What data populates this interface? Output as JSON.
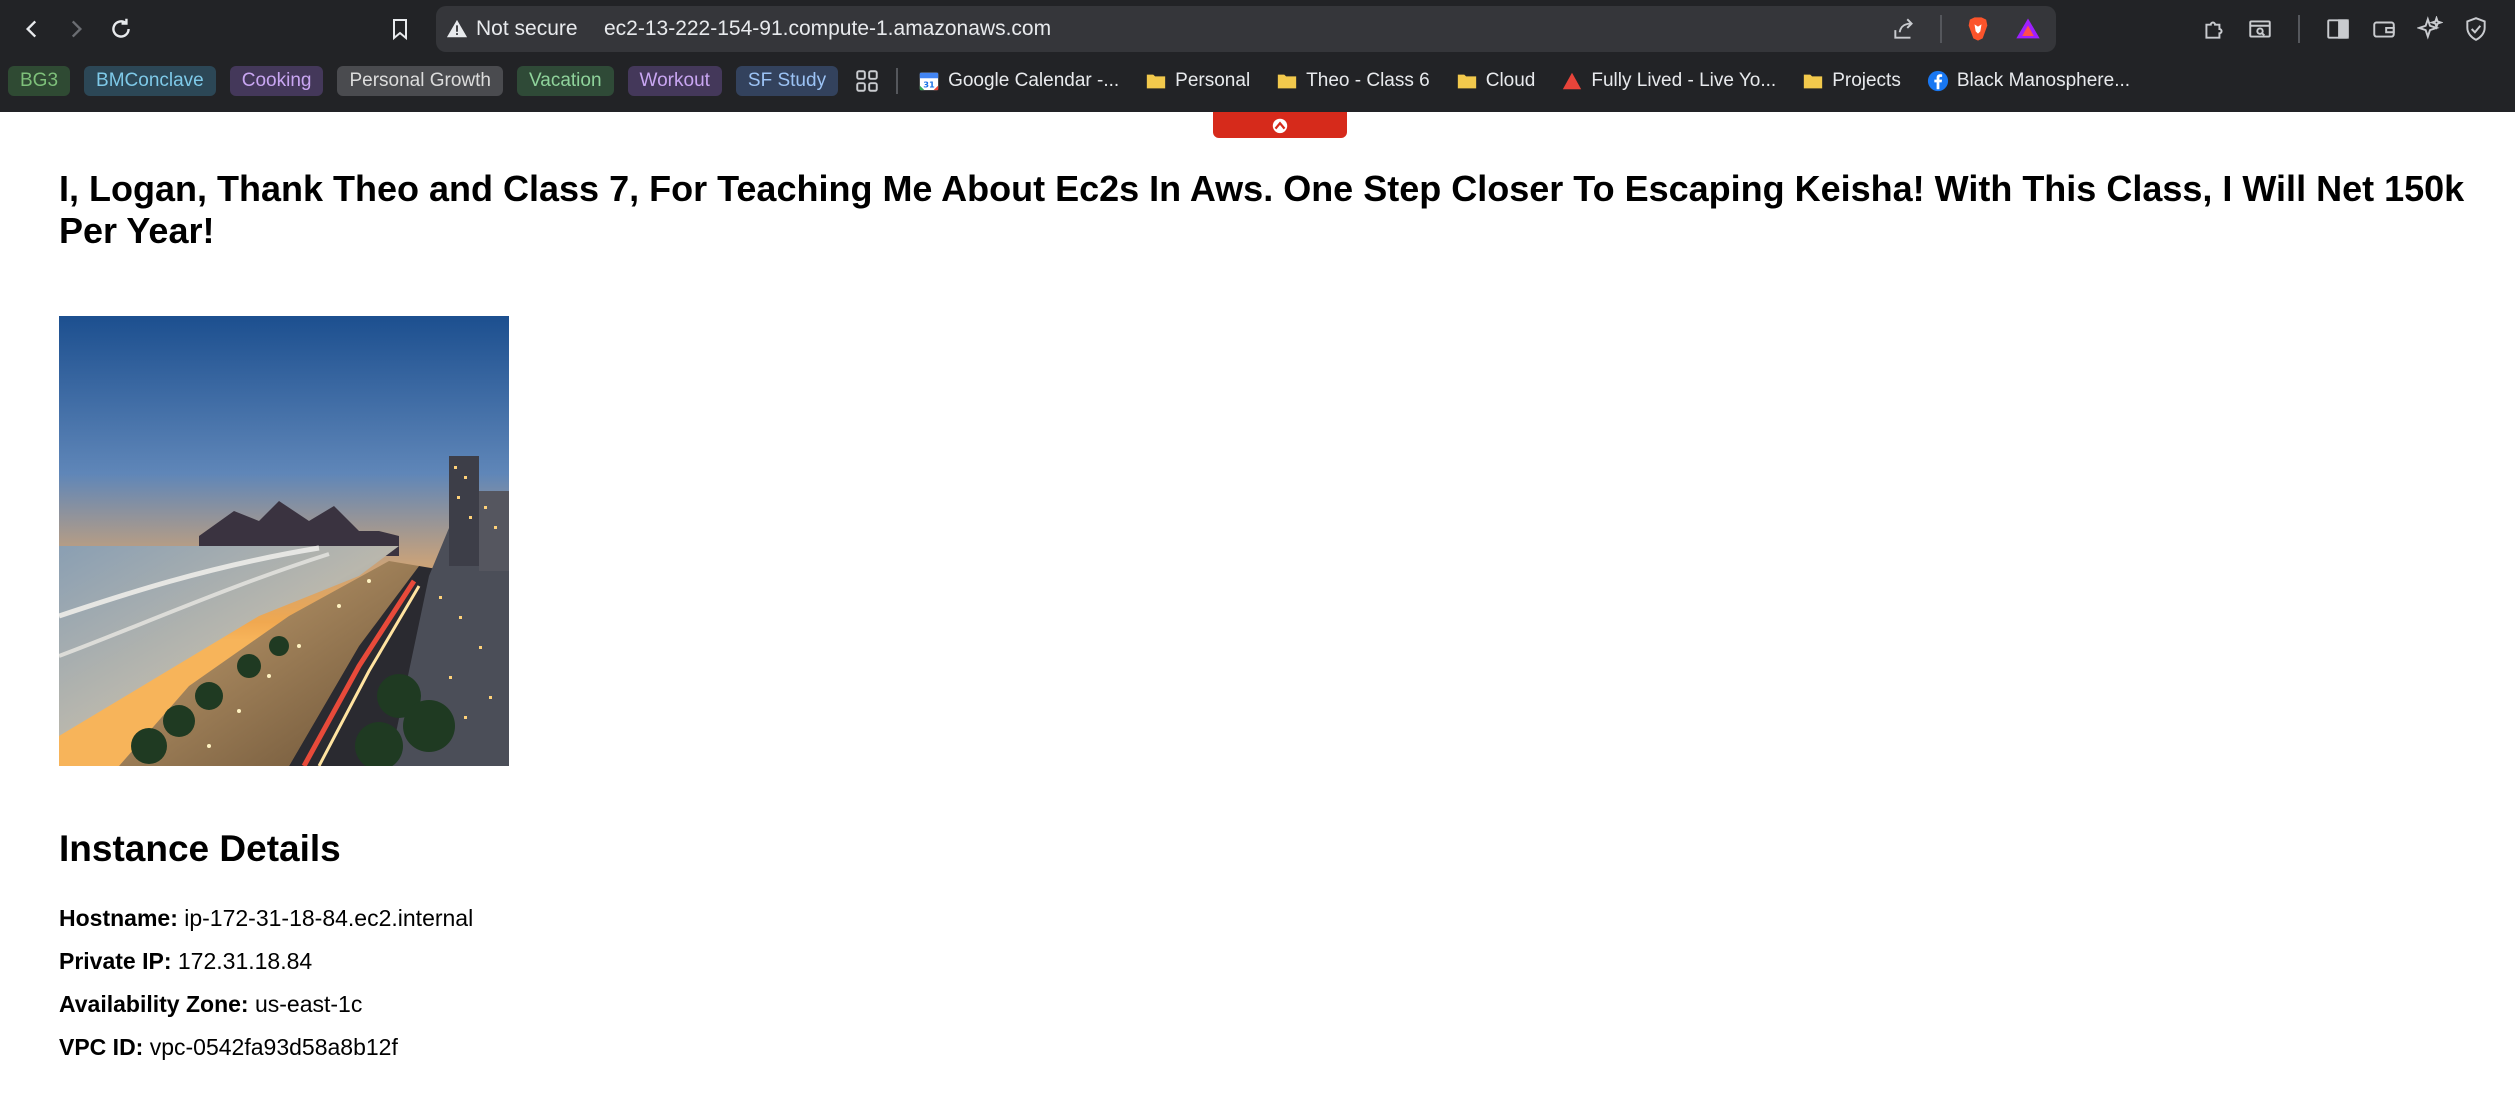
{
  "browser": {
    "security_label": "Not secure",
    "url": "ec2-13-222-154-91.compute-1.amazonaws.com",
    "bookmark_tags": [
      {
        "label": "BG3",
        "color": "#7ec07a",
        "bg": "#2f4a33"
      },
      {
        "label": "BMConclave",
        "color": "#7ec9e8",
        "bg": "#2c4756"
      },
      {
        "label": "Cooking",
        "color": "#c9a6f2",
        "bg": "#44385a"
      },
      {
        "label": "Personal Growth",
        "color": "#dcdcdc",
        "bg": "#4a4b4f"
      },
      {
        "label": "Vacation",
        "color": "#8fd39b",
        "bg": "#2f4a37"
      },
      {
        "label": "Workout",
        "color": "#c9a6f2",
        "bg": "#44385a"
      },
      {
        "label": "SF Study",
        "color": "#9cc3f5",
        "bg": "#33425d"
      }
    ],
    "bookmarks": [
      {
        "label": "Google Calendar -...",
        "icon": "calendar-icon"
      },
      {
        "label": "Personal",
        "icon": "folder-icon"
      },
      {
        "label": "Theo - Class 6",
        "icon": "folder-icon"
      },
      {
        "label": "Cloud",
        "icon": "folder-icon"
      },
      {
        "label": "Fully Lived - Live Yo...",
        "icon": "triangle-logo-icon"
      },
      {
        "label": "Projects",
        "icon": "folder-icon"
      },
      {
        "label": "Black Manosphere...",
        "icon": "facebook-icon"
      }
    ]
  },
  "page": {
    "heading": "I, Logan, Thank Theo and Class 7, For Teaching Me About Ec2s In Aws. One Step Closer To Escaping Keisha! With This Class, I Will Net 150k Per Year!",
    "details_title": "Instance Details",
    "details": [
      {
        "label": "Hostname:",
        "value": "ip-172-31-18-84.ec2.internal"
      },
      {
        "label": "Private IP:",
        "value": "172.31.18.84"
      },
      {
        "label": "Availability Zone:",
        "value": "us-east-1c"
      },
      {
        "label": "VPC ID:",
        "value": "vpc-0542fa93d58a8b12f"
      }
    ]
  }
}
